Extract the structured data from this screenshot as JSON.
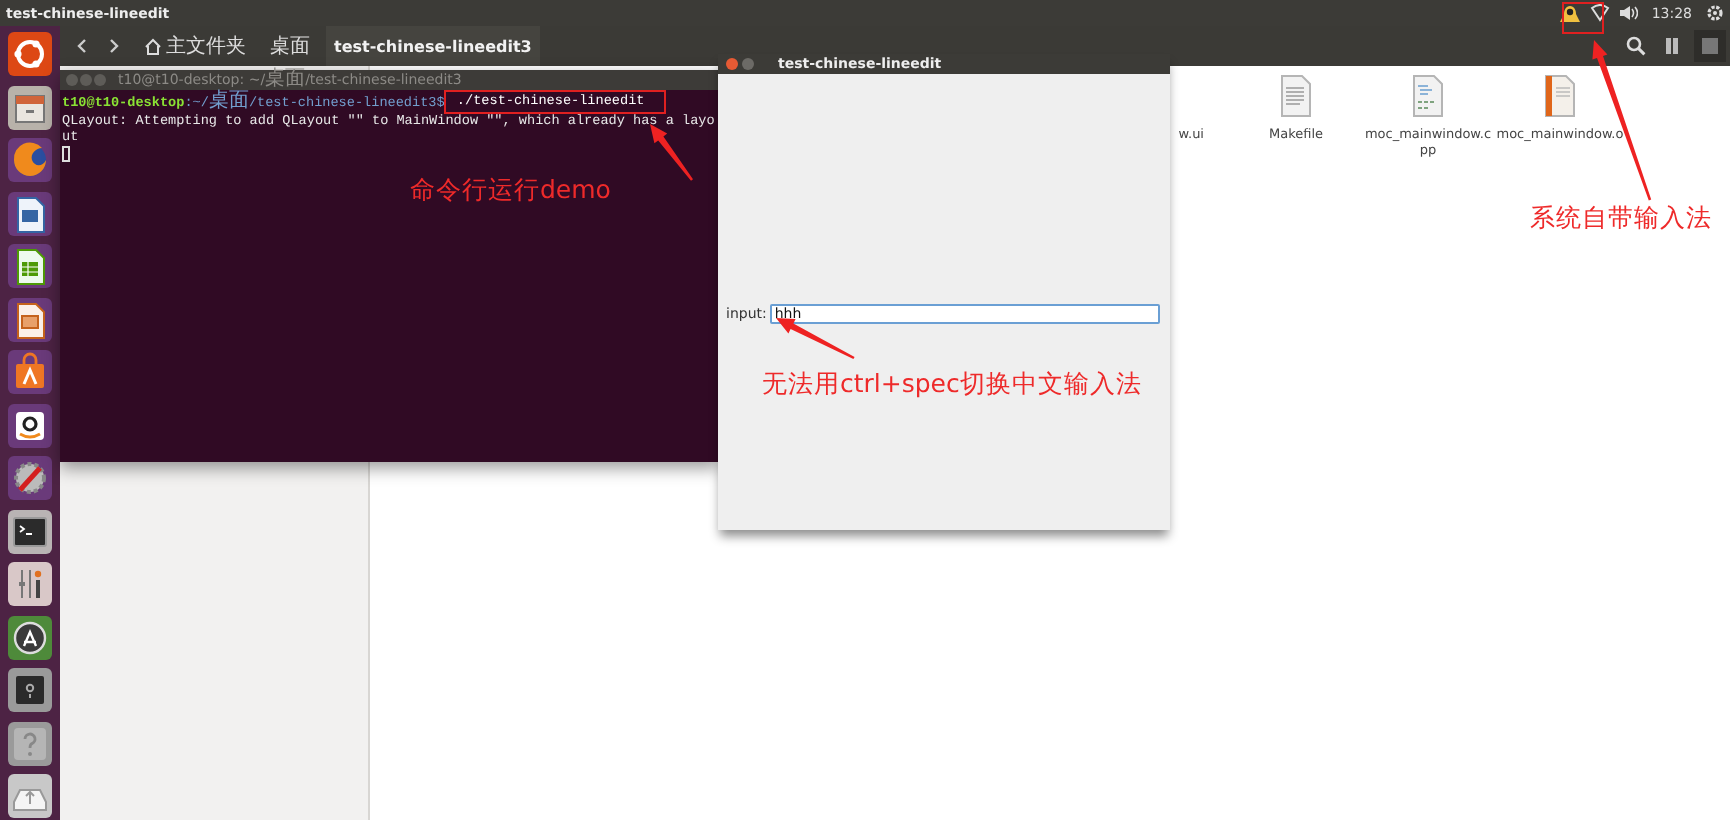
{
  "top_panel": {
    "title": "test-chinese-lineedit",
    "clock": "13:28"
  },
  "file_manager": {
    "breadcrumbs": [
      {
        "label": "主文件夹",
        "kind": "home",
        "selected": false
      },
      {
        "label": "桌面",
        "kind": "folder",
        "selected": false
      },
      {
        "label": "test-chinese-lineedit3",
        "kind": "folder",
        "selected": true
      }
    ],
    "files": [
      {
        "name": "w.ui",
        "kind": "hidden"
      },
      {
        "name": "Makefile",
        "kind": "text"
      },
      {
        "name": "moc_mainwindow.cpp",
        "kind": "source"
      },
      {
        "name": "moc_mainwindow.o",
        "kind": "object"
      }
    ]
  },
  "terminal": {
    "title": "t10@t10-desktop: ~/桌面/test-chinese-lineedit3",
    "prompt_user": "t10@t10-desktop",
    "prompt_path": ":~/桌面/test-chinese-lineedit3$",
    "command": " ./test-chinese-lineedit",
    "output": [
      "QLayout: Attempting to add QLayout \"\" to MainWindow \"\", which already has a layo",
      "ut"
    ]
  },
  "dialog": {
    "title": "test-chinese-lineedit",
    "field_label": "input:",
    "field_value": "hhh"
  },
  "annotations": [
    "命令行运行demo",
    "无法用ctrl+spec切换中文输入法",
    "系统自带输入法"
  ]
}
